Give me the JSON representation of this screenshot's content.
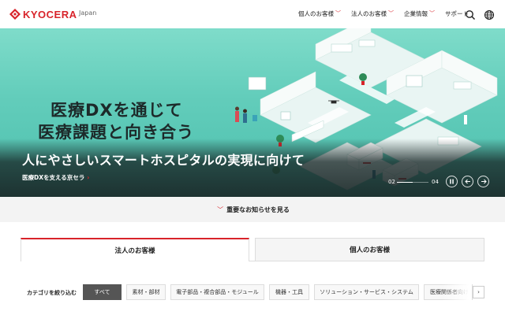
{
  "header": {
    "brand": "KYOCERA",
    "region": "Japan",
    "nav": [
      {
        "label": "個人のお客様"
      },
      {
        "label": "法人のお客様"
      },
      {
        "label": "企業情報"
      },
      {
        "label": "サポート"
      }
    ],
    "icons": [
      "search-icon",
      "globe-icon"
    ]
  },
  "hero": {
    "title_line1": "医療DXを通じて",
    "title_line2": "医療課題と向き合う",
    "headline": "人にやさしいスマートホスピタルの実現に向けて",
    "link_text": "医療DXを支える京セラ",
    "slide_current": "02",
    "slide_total": "04",
    "slide_progress": 0.5,
    "controls": [
      "pause-icon",
      "prev-icon",
      "next-icon"
    ]
  },
  "notice": {
    "label": "重要なお知らせを見る"
  },
  "tabs": [
    {
      "label": "法人のお客様",
      "active": true
    },
    {
      "label": "個人のお客様",
      "active": false
    }
  ],
  "categories": {
    "label": "カテゴリを絞り込む",
    "chips": [
      {
        "label": "すべて",
        "active": true
      },
      {
        "label": "素材・部材"
      },
      {
        "label": "電子部品・複合部品・モジュール"
      },
      {
        "label": "機器・工具"
      },
      {
        "label": "ソリューション・サービス・システム"
      },
      {
        "label": "医療関係者向け"
      }
    ]
  },
  "colors": {
    "accent": "#d8232a",
    "hero_teal": "#63cdbb"
  }
}
